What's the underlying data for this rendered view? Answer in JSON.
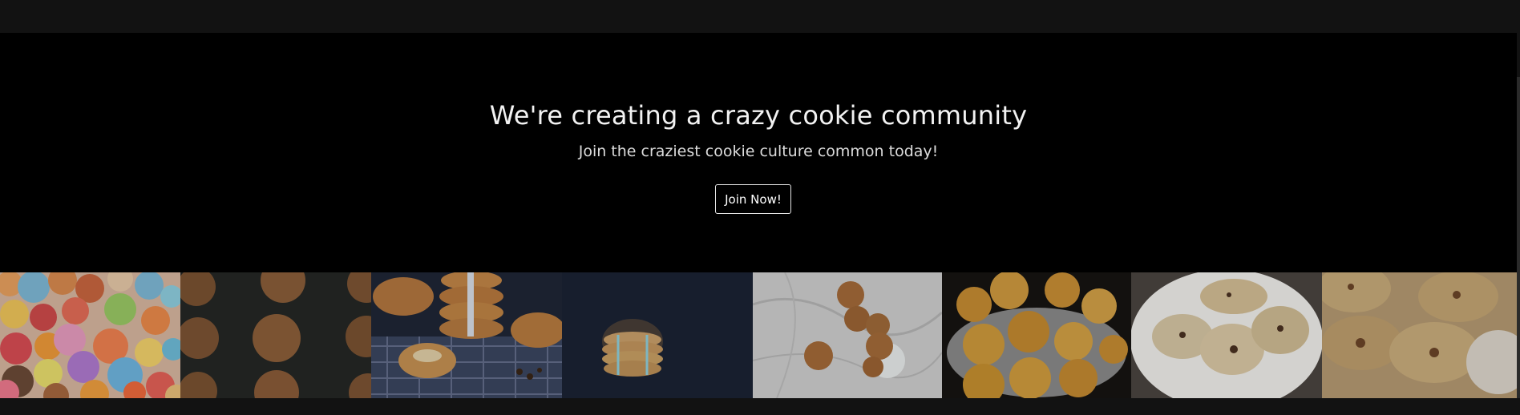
{
  "hero": {
    "title": "We're creating a crazy cookie community",
    "subtitle": "Join the craziest cookie culture common today!",
    "cta_label": "Join Now!"
  },
  "gallery": {
    "images": [
      {
        "subject": "colorful-macarons"
      },
      {
        "subject": "chocolate-cookies-on-dark-surface"
      },
      {
        "subject": "stacked-chocolate-chip-cookies-on-plaid-cloth"
      },
      {
        "subject": "twine-tied-cookie-stack"
      },
      {
        "subject": "cookies-on-marble-with-milk"
      },
      {
        "subject": "cookies-on-tray"
      },
      {
        "subject": "cookies-on-white-plate"
      },
      {
        "subject": "cookies-in-basket"
      }
    ]
  },
  "colors": {
    "page_background": "#121212",
    "hero_background": "#000000",
    "title_text": "#f2f2f2",
    "button_border": "#e6e6e6"
  }
}
